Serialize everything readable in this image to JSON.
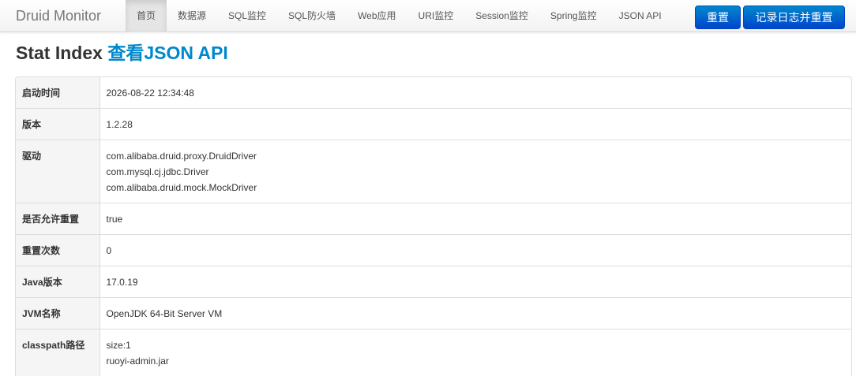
{
  "navbar": {
    "brand": "Druid Monitor",
    "items": [
      {
        "label": "首页",
        "active": true
      },
      {
        "label": "数据源",
        "active": false
      },
      {
        "label": "SQL监控",
        "active": false
      },
      {
        "label": "SQL防火墙",
        "active": false
      },
      {
        "label": "Web应用",
        "active": false
      },
      {
        "label": "URI监控",
        "active": false
      },
      {
        "label": "Session监控",
        "active": false
      },
      {
        "label": "Spring监控",
        "active": false
      },
      {
        "label": "JSON API",
        "active": false
      }
    ],
    "reset_label": "重置",
    "log_reset_label": "记录日志并重置"
  },
  "page": {
    "title": "Stat Index",
    "json_link": "查看JSON API"
  },
  "stats": {
    "start_time": {
      "key": "启动时间",
      "value": "2026-08-22 12:34:48"
    },
    "version": {
      "key": "版本",
      "value": "1.2.28"
    },
    "drivers": {
      "key": "驱动",
      "values": [
        "com.alibaba.druid.proxy.DruidDriver",
        "com.mysql.cj.jdbc.Driver",
        "com.alibaba.druid.mock.MockDriver"
      ]
    },
    "reset_enable": {
      "key": "是否允许重置",
      "value": "true"
    },
    "reset_count": {
      "key": "重置次数",
      "value": "0"
    },
    "java_version": {
      "key": "Java版本",
      "value": "17.0.19"
    },
    "jvm_name": {
      "key": "JVM名称",
      "value": "OpenJDK 64-Bit Server VM"
    },
    "classpath": {
      "key": "classpath路径",
      "values": [
        "size:1",
        "ruoyi-admin.jar"
      ]
    }
  },
  "colors": {
    "accent": "#0088cc",
    "button": "#0044cc",
    "key_bg": "#f5f5f5",
    "border": "#dddddd"
  }
}
